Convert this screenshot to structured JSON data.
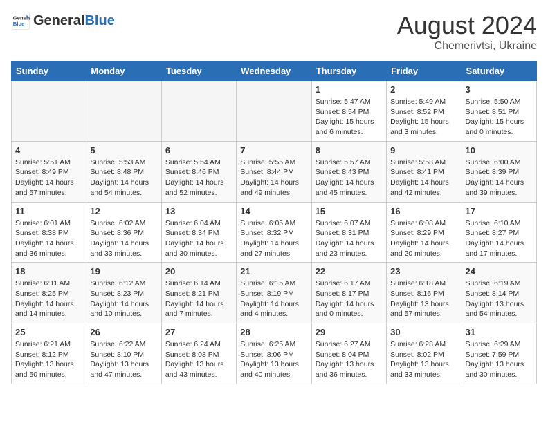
{
  "header": {
    "logo_general": "General",
    "logo_blue": "Blue",
    "month_year": "August 2024",
    "location": "Chemerivtsi, Ukraine"
  },
  "weekdays": [
    "Sunday",
    "Monday",
    "Tuesday",
    "Wednesday",
    "Thursday",
    "Friday",
    "Saturday"
  ],
  "weeks": [
    [
      {
        "day": "",
        "info": ""
      },
      {
        "day": "",
        "info": ""
      },
      {
        "day": "",
        "info": ""
      },
      {
        "day": "",
        "info": ""
      },
      {
        "day": "1",
        "info": "Sunrise: 5:47 AM\nSunset: 8:54 PM\nDaylight: 15 hours and 6 minutes."
      },
      {
        "day": "2",
        "info": "Sunrise: 5:49 AM\nSunset: 8:52 PM\nDaylight: 15 hours and 3 minutes."
      },
      {
        "day": "3",
        "info": "Sunrise: 5:50 AM\nSunset: 8:51 PM\nDaylight: 15 hours and 0 minutes."
      }
    ],
    [
      {
        "day": "4",
        "info": "Sunrise: 5:51 AM\nSunset: 8:49 PM\nDaylight: 14 hours and 57 minutes."
      },
      {
        "day": "5",
        "info": "Sunrise: 5:53 AM\nSunset: 8:48 PM\nDaylight: 14 hours and 54 minutes."
      },
      {
        "day": "6",
        "info": "Sunrise: 5:54 AM\nSunset: 8:46 PM\nDaylight: 14 hours and 52 minutes."
      },
      {
        "day": "7",
        "info": "Sunrise: 5:55 AM\nSunset: 8:44 PM\nDaylight: 14 hours and 49 minutes."
      },
      {
        "day": "8",
        "info": "Sunrise: 5:57 AM\nSunset: 8:43 PM\nDaylight: 14 hours and 45 minutes."
      },
      {
        "day": "9",
        "info": "Sunrise: 5:58 AM\nSunset: 8:41 PM\nDaylight: 14 hours and 42 minutes."
      },
      {
        "day": "10",
        "info": "Sunrise: 6:00 AM\nSunset: 8:39 PM\nDaylight: 14 hours and 39 minutes."
      }
    ],
    [
      {
        "day": "11",
        "info": "Sunrise: 6:01 AM\nSunset: 8:38 PM\nDaylight: 14 hours and 36 minutes."
      },
      {
        "day": "12",
        "info": "Sunrise: 6:02 AM\nSunset: 8:36 PM\nDaylight: 14 hours and 33 minutes."
      },
      {
        "day": "13",
        "info": "Sunrise: 6:04 AM\nSunset: 8:34 PM\nDaylight: 14 hours and 30 minutes."
      },
      {
        "day": "14",
        "info": "Sunrise: 6:05 AM\nSunset: 8:32 PM\nDaylight: 14 hours and 27 minutes."
      },
      {
        "day": "15",
        "info": "Sunrise: 6:07 AM\nSunset: 8:31 PM\nDaylight: 14 hours and 23 minutes."
      },
      {
        "day": "16",
        "info": "Sunrise: 6:08 AM\nSunset: 8:29 PM\nDaylight: 14 hours and 20 minutes."
      },
      {
        "day": "17",
        "info": "Sunrise: 6:10 AM\nSunset: 8:27 PM\nDaylight: 14 hours and 17 minutes."
      }
    ],
    [
      {
        "day": "18",
        "info": "Sunrise: 6:11 AM\nSunset: 8:25 PM\nDaylight: 14 hours and 14 minutes."
      },
      {
        "day": "19",
        "info": "Sunrise: 6:12 AM\nSunset: 8:23 PM\nDaylight: 14 hours and 10 minutes."
      },
      {
        "day": "20",
        "info": "Sunrise: 6:14 AM\nSunset: 8:21 PM\nDaylight: 14 hours and 7 minutes."
      },
      {
        "day": "21",
        "info": "Sunrise: 6:15 AM\nSunset: 8:19 PM\nDaylight: 14 hours and 4 minutes."
      },
      {
        "day": "22",
        "info": "Sunrise: 6:17 AM\nSunset: 8:17 PM\nDaylight: 14 hours and 0 minutes."
      },
      {
        "day": "23",
        "info": "Sunrise: 6:18 AM\nSunset: 8:16 PM\nDaylight: 13 hours and 57 minutes."
      },
      {
        "day": "24",
        "info": "Sunrise: 6:19 AM\nSunset: 8:14 PM\nDaylight: 13 hours and 54 minutes."
      }
    ],
    [
      {
        "day": "25",
        "info": "Sunrise: 6:21 AM\nSunset: 8:12 PM\nDaylight: 13 hours and 50 minutes."
      },
      {
        "day": "26",
        "info": "Sunrise: 6:22 AM\nSunset: 8:10 PM\nDaylight: 13 hours and 47 minutes."
      },
      {
        "day": "27",
        "info": "Sunrise: 6:24 AM\nSunset: 8:08 PM\nDaylight: 13 hours and 43 minutes."
      },
      {
        "day": "28",
        "info": "Sunrise: 6:25 AM\nSunset: 8:06 PM\nDaylight: 13 hours and 40 minutes."
      },
      {
        "day": "29",
        "info": "Sunrise: 6:27 AM\nSunset: 8:04 PM\nDaylight: 13 hours and 36 minutes."
      },
      {
        "day": "30",
        "info": "Sunrise: 6:28 AM\nSunset: 8:02 PM\nDaylight: 13 hours and 33 minutes."
      },
      {
        "day": "31",
        "info": "Sunrise: 6:29 AM\nSunset: 7:59 PM\nDaylight: 13 hours and 30 minutes."
      }
    ]
  ]
}
